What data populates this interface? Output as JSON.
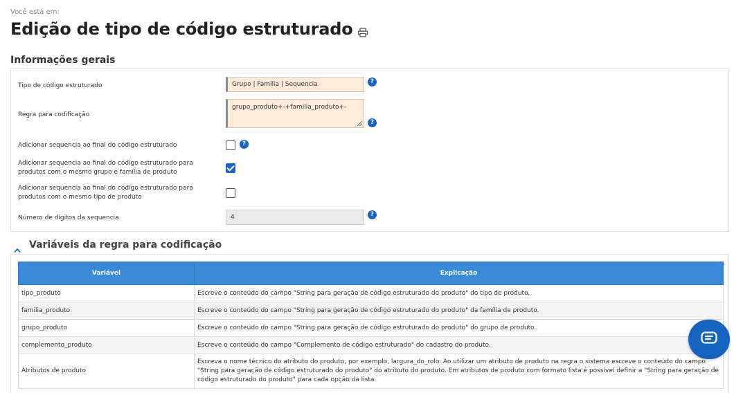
{
  "breadcrumb": "Você está em:",
  "page_title": "Edição de tipo de código estruturado",
  "general_section": {
    "title": "Informações gerais",
    "fields": {
      "tipo_label": "Tipo de código estruturado",
      "tipo_value": "Grupo | Família | Sequencia",
      "regra_label": "Regra para codificação",
      "regra_value": "grupo_produto+-+familia_produto+-",
      "seq_final_label": "Adicionar sequencia ao final do código estruturado",
      "seq_final_checked": false,
      "seq_grupo_label": "Adicionar sequencia ao final do código estruturado para produtos com o mesmo grupo e família de produto",
      "seq_grupo_checked": true,
      "seq_tipo_label": "Adicionar sequencia ao final do código estruturado para produtos com o mesmo tipo de produto",
      "seq_tipo_checked": false,
      "digitos_label": "Número de dígitos da sequencia",
      "digitos_value": "4"
    },
    "help_symbol": "?"
  },
  "variables_section": {
    "title": "Variáveis da regra para codificação",
    "columns": [
      "Variável",
      "Explicação"
    ],
    "rows": [
      {
        "var": "tipo_produto",
        "exp": "Escreve o conteúdo do campo \"String para geração de código estruturado do produto\" do tipo de produto."
      },
      {
        "var": "familia_produto",
        "exp": "Escreve o conteúdo do campo \"String para geração de código estruturado do produto\" da família de produto."
      },
      {
        "var": "grupo_produto",
        "exp": "Escreve o conteúdo do campo \"String para geração de código estruturado do produto\" do grupo de produto."
      },
      {
        "var": "complemento_produto",
        "exp": "Escreve o conteúdo do campo \"Complemento de código estruturado\" do cadastro do produto."
      },
      {
        "var": "Atributos de produto",
        "exp": "Escreva o nome técnico do atributo do produto, por exemplo, largura_do_rolo. Ao utilizar um atributo de produto na regra o sistema escreve o conteúdo do campo \"String para geração de código estruturado do produto\" do atributo do produto. Em atributos de produto com formato lista é possível definir a \"String para geração de código estruturado do produto\" para cada opção da lista."
      }
    ]
  },
  "colors": {
    "accent": "#1a64c8",
    "table_header": "#3a8ad8",
    "input_bg": "#fdebd9",
    "chat_button": "#1565c0"
  },
  "icons": {
    "print": "print-icon",
    "help": "help-icon",
    "collapse": "chevron-up-icon",
    "chat": "chat-icon"
  }
}
